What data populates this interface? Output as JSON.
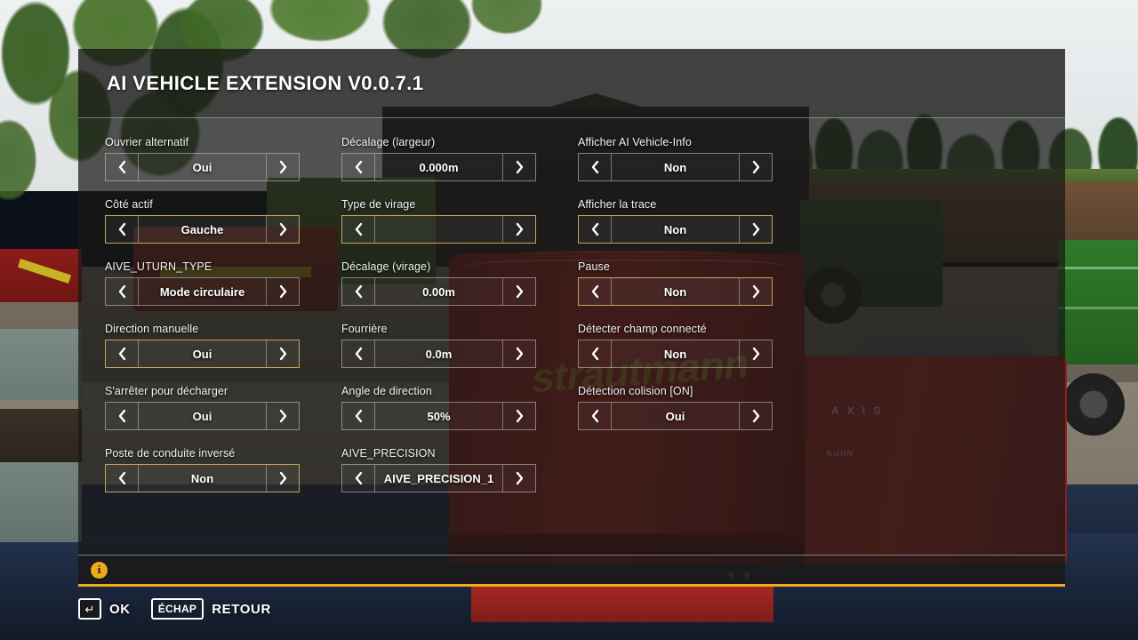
{
  "dialog": {
    "title": "AI VEHICLE EXTENSION V0.0.7.1"
  },
  "accent_colors": {
    "selected_border": "#c8a45c",
    "footer_rule": "#f0a81e",
    "info_icon_bg": "#f0a81e"
  },
  "arrows": {
    "prev": "‹",
    "next": "›"
  },
  "columns": [
    {
      "id": "column-left",
      "settings": [
        {
          "label": "Ouvrier alternatif",
          "value": "Oui",
          "selected": false
        },
        {
          "label": "Côté actif",
          "value": "Gauche",
          "selected": true
        },
        {
          "label": "AIVE_UTURN_TYPE",
          "value": "Mode circulaire",
          "selected": false
        },
        {
          "label": "Direction manuelle",
          "value": "Oui",
          "selected": true
        },
        {
          "label": "S'arrêter pour décharger",
          "value": "Oui",
          "selected": false
        },
        {
          "label": "Poste de conduite inversé",
          "value": "Non",
          "selected": true
        }
      ]
    },
    {
      "id": "column-middle",
      "settings": [
        {
          "label": "Décalage (largeur)",
          "value": "0.000m",
          "selected": false
        },
        {
          "label": "Type de virage",
          "value": "",
          "selected": true
        },
        {
          "label": "Décalage (virage)",
          "value": "0.00m",
          "selected": false
        },
        {
          "label": "Fourrière",
          "value": "0.0m",
          "selected": false
        },
        {
          "label": "Angle de direction",
          "value": "50%",
          "selected": false
        },
        {
          "label": "AIVE_PRECISION",
          "value": "AIVE_PRECISION_1",
          "selected": false
        }
      ]
    },
    {
      "id": "column-right",
      "settings": [
        {
          "label": "Afficher AI Vehicle-Info",
          "value": "Non",
          "selected": false
        },
        {
          "label": "Afficher la trace",
          "value": "Non",
          "selected": true
        },
        {
          "label": "Pause",
          "value": "Non",
          "selected": true
        },
        {
          "label": "Détecter champ connecté",
          "value": "Non",
          "selected": false
        },
        {
          "label": "Détection colision [ON]",
          "value": "Oui",
          "selected": false
        }
      ]
    }
  ],
  "footer": {
    "info_glyph": "i"
  },
  "actionbar": {
    "enter_key_glyph": "↵",
    "ok_label": "OK",
    "esc_key_label": "ÉCHAP",
    "back_label": "RETOUR"
  },
  "background": {
    "watermark_text": "strautmann",
    "spreader_brand": "A X I S",
    "spreader_maker": "KUHN",
    "arrow_marks": "▼▼"
  }
}
